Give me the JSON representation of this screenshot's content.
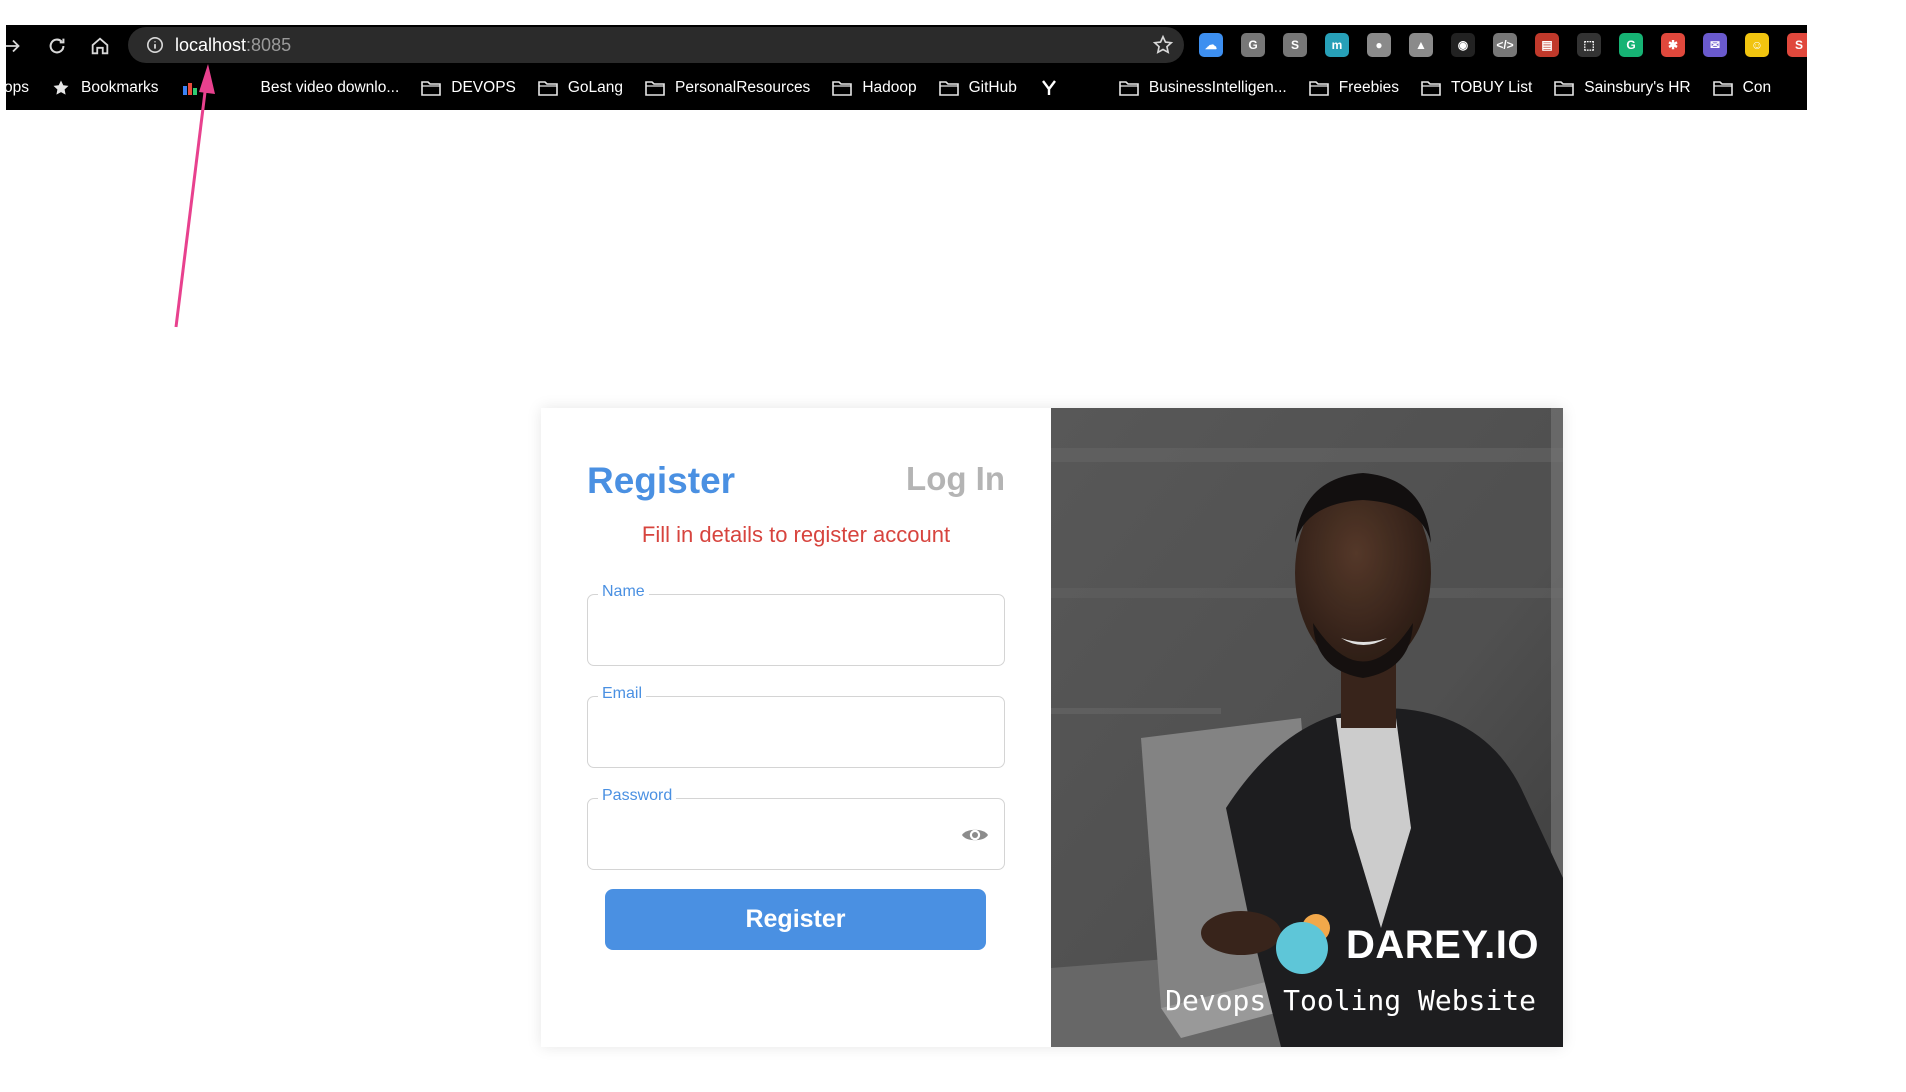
{
  "browser": {
    "url_host": "localhost",
    "url_port": ":8085",
    "bookmarks": [
      {
        "label": "ops",
        "icon": "none"
      },
      {
        "label": "Bookmarks",
        "icon": "star-icon"
      },
      {
        "label": "",
        "icon": "chart-icon"
      },
      {
        "label": "Best video downlo...",
        "icon": "none"
      },
      {
        "label": "DEVOPS",
        "icon": "folder-icon"
      },
      {
        "label": "GoLang",
        "icon": "folder-icon"
      },
      {
        "label": "PersonalResources",
        "icon": "folder-icon"
      },
      {
        "label": "Hadoop",
        "icon": "folder-icon"
      },
      {
        "label": "GitHub",
        "icon": "folder-icon"
      },
      {
        "label": "",
        "icon": "y-logo-icon"
      },
      {
        "label": "BusinessIntelligen...",
        "icon": "folder-icon"
      },
      {
        "label": "Freebies",
        "icon": "folder-icon"
      },
      {
        "label": "TOBUY List",
        "icon": "folder-icon"
      },
      {
        "label": "Sainsbury's HR",
        "icon": "folder-icon"
      },
      {
        "label": "Con",
        "icon": "folder-icon"
      }
    ],
    "extensions": [
      {
        "name": "cloud-extension-icon",
        "glyph": "☁",
        "color": "#3d8ff0"
      },
      {
        "name": "grammar-extension-icon",
        "glyph": "G",
        "color": "#777777"
      },
      {
        "name": "skype-extension-icon",
        "glyph": "S",
        "color": "#777777"
      },
      {
        "name": "m-extension-icon",
        "glyph": "m",
        "color": "#27a0b8"
      },
      {
        "name": "record-extension-icon",
        "glyph": "●",
        "color": "#8a8a8a"
      },
      {
        "name": "drive-extension-icon",
        "glyph": "▲",
        "color": "#8a8a8a"
      },
      {
        "name": "github-extension-icon",
        "glyph": "◉",
        "color": "#222222"
      },
      {
        "name": "code-extension-icon",
        "glyph": "</>",
        "color": "#777777"
      },
      {
        "name": "store-extension-icon",
        "glyph": "▤",
        "color": "#c0392b"
      },
      {
        "name": "selection-extension-icon",
        "glyph": "⬚",
        "color": "#333333"
      },
      {
        "name": "grammarly-extension-icon",
        "glyph": "G",
        "color": "#16b374"
      },
      {
        "name": "crab-extension-icon",
        "glyph": "✱",
        "color": "#e0483c"
      },
      {
        "name": "mail-extension-icon",
        "glyph": "✉",
        "color": "#6a5acd"
      },
      {
        "name": "ghost-extension-icon",
        "glyph": "☺",
        "color": "#f1c40f"
      },
      {
        "name": "s-extension-icon",
        "glyph": "S",
        "color": "#e0483c"
      }
    ]
  },
  "auth": {
    "tab_register": "Register",
    "tab_login": "Log In",
    "subtitle": "Fill in details to register account",
    "name_label": "Name",
    "email_label": "Email",
    "password_label": "Password",
    "name_value": "",
    "email_value": "",
    "password_value": "",
    "submit_label": "Register"
  },
  "brand": {
    "name": "DAREY.IO",
    "tagline": "Devops Tooling Website"
  },
  "colors": {
    "accent": "#4a90e2",
    "error": "#d7443e",
    "inactive_tab": "#b4b4b4",
    "annotation": "#e8418e"
  }
}
